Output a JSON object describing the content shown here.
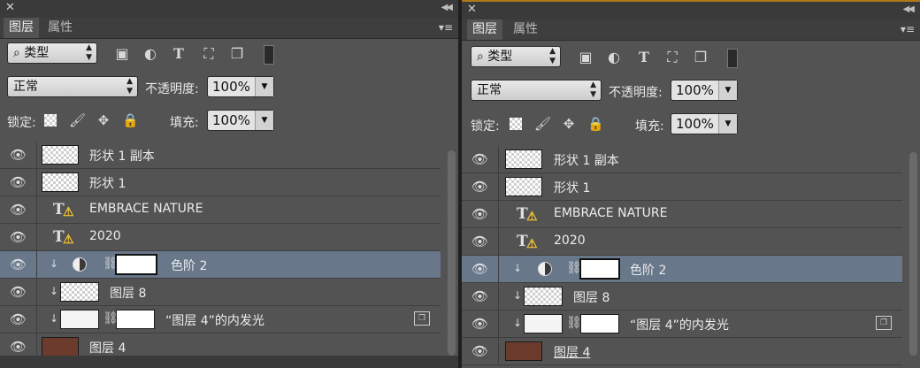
{
  "panels": [
    {
      "tabs": [
        "图层",
        "属性"
      ],
      "filter": {
        "kind": "类型",
        "icons": [
          "image-filter-icon",
          "adjustment-filter-icon",
          "type-filter-icon",
          "shape-filter-icon",
          "smart-object-filter-icon",
          "filter-toggle-icon"
        ]
      },
      "blend": {
        "mode": "正常",
        "opacity_label": "不透明度:",
        "opacity": "100%"
      },
      "lock": {
        "label": "锁定:",
        "fill_label": "填充:",
        "fill": "100%"
      },
      "layers": [
        {
          "name": "形状 1 副本",
          "kind": "shape"
        },
        {
          "name": "形状 1",
          "kind": "shape"
        },
        {
          "name": "EMBRACE NATURE",
          "kind": "text"
        },
        {
          "name": "2020",
          "kind": "text"
        },
        {
          "name": "色阶 2",
          "kind": "adjustment",
          "selected": true
        },
        {
          "name": "图层 8",
          "kind": "pixel"
        },
        {
          "name": "“图层 4”的内发光",
          "kind": "effect"
        },
        {
          "name": "图层 4",
          "kind": "photo"
        }
      ]
    },
    {
      "tabs": [
        "图层",
        "属性"
      ],
      "filter": {
        "kind": "类型",
        "icons": [
          "image-filter-icon",
          "adjustment-filter-icon",
          "type-filter-icon",
          "shape-filter-icon",
          "smart-object-filter-icon",
          "filter-toggle-icon"
        ]
      },
      "blend": {
        "mode": "正常",
        "opacity_label": "不透明度:",
        "opacity": "100%"
      },
      "lock": {
        "label": "锁定:",
        "fill_label": "填充:",
        "fill": "100%"
      },
      "layers": [
        {
          "name": "形状 1 副本",
          "kind": "shape"
        },
        {
          "name": "形状 1",
          "kind": "shape"
        },
        {
          "name": "EMBRACE NATURE",
          "kind": "text"
        },
        {
          "name": "2020",
          "kind": "text"
        },
        {
          "name": "色阶 2",
          "kind": "adjustment",
          "selected": true
        },
        {
          "name": "图层 8",
          "kind": "pixel"
        },
        {
          "name": "“图层 4”的内发光",
          "kind": "effect"
        },
        {
          "name": "图层 4",
          "kind": "photo"
        }
      ]
    }
  ],
  "colors": {
    "panel_bg": "#535353",
    "selected_row": "#68778a",
    "warning": "#f1c232",
    "active_border": "#b07818"
  }
}
